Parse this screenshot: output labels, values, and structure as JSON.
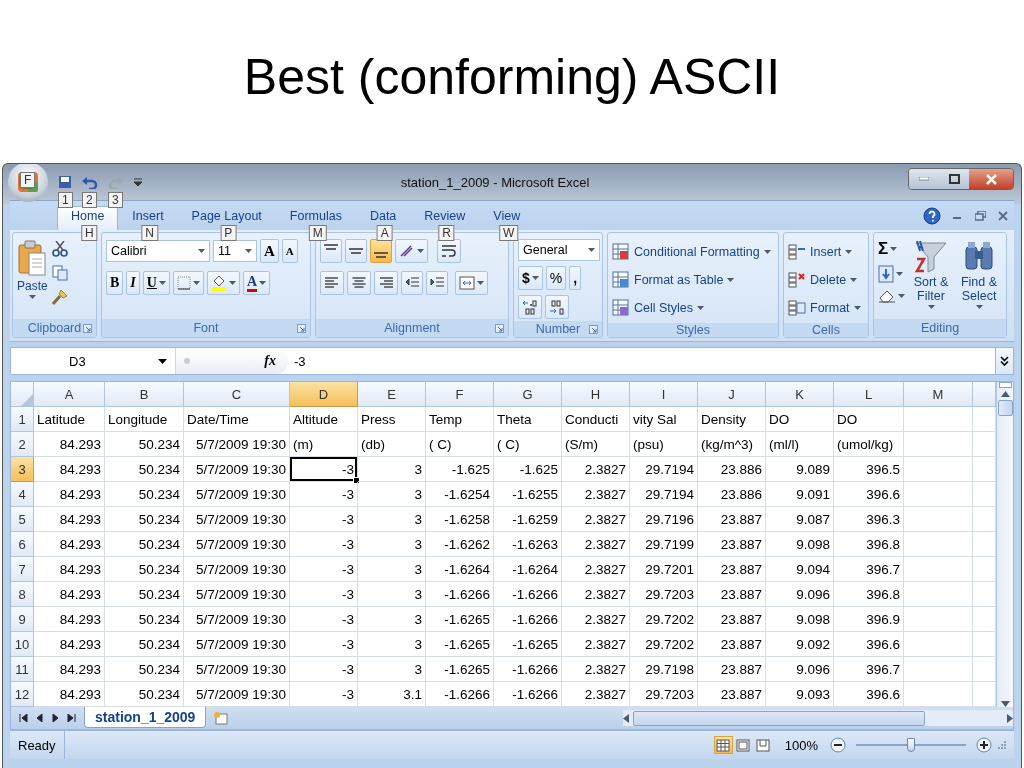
{
  "slide": {
    "title": "Best (conforming) ASCII"
  },
  "window": {
    "title": "station_1_2009 - Microsoft Excel",
    "office_keytip": "F",
    "quick_access_keytips": [
      "1",
      "2",
      "3"
    ]
  },
  "tabs": [
    {
      "label": "Home",
      "keytip": "H",
      "selected": true
    },
    {
      "label": "Insert",
      "keytip": "N",
      "selected": false
    },
    {
      "label": "Page Layout",
      "keytip": "P",
      "selected": false
    },
    {
      "label": "Formulas",
      "keytip": "M",
      "selected": false
    },
    {
      "label": "Data",
      "keytip": "A",
      "selected": false
    },
    {
      "label": "Review",
      "keytip": "R",
      "selected": false
    },
    {
      "label": "View",
      "keytip": "W",
      "selected": false
    }
  ],
  "ribbon": {
    "clipboard": {
      "label": "Clipboard",
      "paste": "Paste"
    },
    "font": {
      "label": "Font",
      "name": "Calibri",
      "size": "11",
      "grow": "A",
      "shrink": "A",
      "bold": "B",
      "italic": "I",
      "underline": "U",
      "font_color": "A"
    },
    "alignment": {
      "label": "Alignment",
      "vertical": [
        {
          "kind": "top",
          "selected": false
        },
        {
          "kind": "middle",
          "selected": false
        },
        {
          "kind": "bottom",
          "selected": true
        }
      ]
    },
    "number": {
      "label": "Number",
      "format": "General",
      "currency": "$",
      "percent": "%",
      "comma": ","
    },
    "styles": {
      "label": "Styles",
      "items": [
        "Conditional Formatting",
        "Format as Table",
        "Cell Styles"
      ]
    },
    "cells": {
      "label": "Cells",
      "items": [
        "Insert",
        "Delete",
        "Format"
      ]
    },
    "editing": {
      "label": "Editing",
      "sum": "Σ",
      "sort": "Sort & Filter",
      "find": "Find & Select"
    }
  },
  "formula_bar": {
    "name_box": "D3",
    "function_label": "fx",
    "value": "-3"
  },
  "sheet": {
    "columns": [
      {
        "label": "A",
        "selected": false
      },
      {
        "label": "B",
        "selected": false
      },
      {
        "label": "C",
        "selected": false
      },
      {
        "label": "D",
        "selected": true
      },
      {
        "label": "E",
        "selected": false
      },
      {
        "label": "F",
        "selected": false
      },
      {
        "label": "G",
        "selected": false
      },
      {
        "label": "H",
        "selected": false
      },
      {
        "label": "I",
        "selected": false
      },
      {
        "label": "J",
        "selected": false
      },
      {
        "label": "K",
        "selected": false
      },
      {
        "label": "L",
        "selected": false
      },
      {
        "label": "M",
        "selected": false
      }
    ],
    "rows": [
      {
        "label": "1",
        "selected": false,
        "cells": [
          {
            "text": "Latitude",
            "kind": "text"
          },
          {
            "text": "Longitude",
            "kind": "text"
          },
          {
            "text": "Date/Time",
            "kind": "text"
          },
          {
            "text": "Altitude",
            "kind": "text"
          },
          {
            "text": "Press",
            "kind": "text"
          },
          {
            "text": "Temp",
            "kind": "text"
          },
          {
            "text": "Theta",
            "kind": "text"
          },
          {
            "text": "Conducti",
            "kind": "text"
          },
          {
            "text": "vity Sal",
            "kind": "text"
          },
          {
            "text": "Density",
            "kind": "text"
          },
          {
            "text": "DO",
            "kind": "text"
          },
          {
            "text": "DO",
            "kind": "text"
          }
        ]
      },
      {
        "label": "2",
        "selected": false,
        "cells": [
          {
            "text": "84.293",
            "kind": "number"
          },
          {
            "text": "50.234",
            "kind": "number"
          },
          {
            "text": "5/7/2009 19:30",
            "kind": "number"
          },
          {
            "text": "(m)",
            "kind": "text"
          },
          {
            "text": "(db)",
            "kind": "text"
          },
          {
            "text": "( C)",
            "kind": "text"
          },
          {
            "text": "( C)",
            "kind": "text"
          },
          {
            "text": "(S/m)",
            "kind": "text"
          },
          {
            "text": "(psu)",
            "kind": "text"
          },
          {
            "text": "(kg/m^3)",
            "kind": "text"
          },
          {
            "text": "(ml/l)",
            "kind": "text"
          },
          {
            "text": "(umol/kg)",
            "kind": "text"
          }
        ]
      },
      {
        "label": "3",
        "selected": true,
        "cells": [
          {
            "text": "84.293",
            "kind": "number"
          },
          {
            "text": "50.234",
            "kind": "number"
          },
          {
            "text": "5/7/2009 19:30",
            "kind": "number"
          },
          {
            "text": "-3",
            "kind": "number"
          },
          {
            "text": "3",
            "kind": "number"
          },
          {
            "text": "-1.625",
            "kind": "number"
          },
          {
            "text": "-1.625",
            "kind": "number"
          },
          {
            "text": "2.3827",
            "kind": "number"
          },
          {
            "text": "29.7194",
            "kind": "number"
          },
          {
            "text": "23.886",
            "kind": "number"
          },
          {
            "text": "9.089",
            "kind": "number"
          },
          {
            "text": "396.5",
            "kind": "number"
          }
        ]
      },
      {
        "label": "4",
        "selected": false,
        "cells": [
          {
            "text": "84.293",
            "kind": "number"
          },
          {
            "text": "50.234",
            "kind": "number"
          },
          {
            "text": "5/7/2009 19:30",
            "kind": "number"
          },
          {
            "text": "-3",
            "kind": "number"
          },
          {
            "text": "3",
            "kind": "number"
          },
          {
            "text": "-1.6254",
            "kind": "number"
          },
          {
            "text": "-1.6255",
            "kind": "number"
          },
          {
            "text": "2.3827",
            "kind": "number"
          },
          {
            "text": "29.7194",
            "kind": "number"
          },
          {
            "text": "23.886",
            "kind": "number"
          },
          {
            "text": "9.091",
            "kind": "number"
          },
          {
            "text": "396.6",
            "kind": "number"
          }
        ]
      },
      {
        "label": "5",
        "selected": false,
        "cells": [
          {
            "text": "84.293",
            "kind": "number"
          },
          {
            "text": "50.234",
            "kind": "number"
          },
          {
            "text": "5/7/2009 19:30",
            "kind": "number"
          },
          {
            "text": "-3",
            "kind": "number"
          },
          {
            "text": "3",
            "kind": "number"
          },
          {
            "text": "-1.6258",
            "kind": "number"
          },
          {
            "text": "-1.6259",
            "kind": "number"
          },
          {
            "text": "2.3827",
            "kind": "number"
          },
          {
            "text": "29.7196",
            "kind": "number"
          },
          {
            "text": "23.887",
            "kind": "number"
          },
          {
            "text": "9.087",
            "kind": "number"
          },
          {
            "text": "396.3",
            "kind": "number"
          }
        ]
      },
      {
        "label": "6",
        "selected": false,
        "cells": [
          {
            "text": "84.293",
            "kind": "number"
          },
          {
            "text": "50.234",
            "kind": "number"
          },
          {
            "text": "5/7/2009 19:30",
            "kind": "number"
          },
          {
            "text": "-3",
            "kind": "number"
          },
          {
            "text": "3",
            "kind": "number"
          },
          {
            "text": "-1.6262",
            "kind": "number"
          },
          {
            "text": "-1.6263",
            "kind": "number"
          },
          {
            "text": "2.3827",
            "kind": "number"
          },
          {
            "text": "29.7199",
            "kind": "number"
          },
          {
            "text": "23.887",
            "kind": "number"
          },
          {
            "text": "9.098",
            "kind": "number"
          },
          {
            "text": "396.8",
            "kind": "number"
          }
        ]
      },
      {
        "label": "7",
        "selected": false,
        "cells": [
          {
            "text": "84.293",
            "kind": "number"
          },
          {
            "text": "50.234",
            "kind": "number"
          },
          {
            "text": "5/7/2009 19:30",
            "kind": "number"
          },
          {
            "text": "-3",
            "kind": "number"
          },
          {
            "text": "3",
            "kind": "number"
          },
          {
            "text": "-1.6264",
            "kind": "number"
          },
          {
            "text": "-1.6264",
            "kind": "number"
          },
          {
            "text": "2.3827",
            "kind": "number"
          },
          {
            "text": "29.7201",
            "kind": "number"
          },
          {
            "text": "23.887",
            "kind": "number"
          },
          {
            "text": "9.094",
            "kind": "number"
          },
          {
            "text": "396.7",
            "kind": "number"
          }
        ]
      },
      {
        "label": "8",
        "selected": false,
        "cells": [
          {
            "text": "84.293",
            "kind": "number"
          },
          {
            "text": "50.234",
            "kind": "number"
          },
          {
            "text": "5/7/2009 19:30",
            "kind": "number"
          },
          {
            "text": "-3",
            "kind": "number"
          },
          {
            "text": "3",
            "kind": "number"
          },
          {
            "text": "-1.6266",
            "kind": "number"
          },
          {
            "text": "-1.6266",
            "kind": "number"
          },
          {
            "text": "2.3827",
            "kind": "number"
          },
          {
            "text": "29.7203",
            "kind": "number"
          },
          {
            "text": "23.887",
            "kind": "number"
          },
          {
            "text": "9.096",
            "kind": "number"
          },
          {
            "text": "396.8",
            "kind": "number"
          }
        ]
      },
      {
        "label": "9",
        "selected": false,
        "cells": [
          {
            "text": "84.293",
            "kind": "number"
          },
          {
            "text": "50.234",
            "kind": "number"
          },
          {
            "text": "5/7/2009 19:30",
            "kind": "number"
          },
          {
            "text": "-3",
            "kind": "number"
          },
          {
            "text": "3",
            "kind": "number"
          },
          {
            "text": "-1.6265",
            "kind": "number"
          },
          {
            "text": "-1.6266",
            "kind": "number"
          },
          {
            "text": "2.3827",
            "kind": "number"
          },
          {
            "text": "29.7202",
            "kind": "number"
          },
          {
            "text": "23.887",
            "kind": "number"
          },
          {
            "text": "9.098",
            "kind": "number"
          },
          {
            "text": "396.9",
            "kind": "number"
          }
        ]
      },
      {
        "label": "10",
        "selected": false,
        "cells": [
          {
            "text": "84.293",
            "kind": "number"
          },
          {
            "text": "50.234",
            "kind": "number"
          },
          {
            "text": "5/7/2009 19:30",
            "kind": "number"
          },
          {
            "text": "-3",
            "kind": "number"
          },
          {
            "text": "3",
            "kind": "number"
          },
          {
            "text": "-1.6265",
            "kind": "number"
          },
          {
            "text": "-1.6265",
            "kind": "number"
          },
          {
            "text": "2.3827",
            "kind": "number"
          },
          {
            "text": "29.7202",
            "kind": "number"
          },
          {
            "text": "23.887",
            "kind": "number"
          },
          {
            "text": "9.092",
            "kind": "number"
          },
          {
            "text": "396.6",
            "kind": "number"
          }
        ]
      },
      {
        "label": "11",
        "selected": false,
        "cells": [
          {
            "text": "84.293",
            "kind": "number"
          },
          {
            "text": "50.234",
            "kind": "number"
          },
          {
            "text": "5/7/2009 19:30",
            "kind": "number"
          },
          {
            "text": "-3",
            "kind": "number"
          },
          {
            "text": "3",
            "kind": "number"
          },
          {
            "text": "-1.6265",
            "kind": "number"
          },
          {
            "text": "-1.6266",
            "kind": "number"
          },
          {
            "text": "2.3827",
            "kind": "number"
          },
          {
            "text": "29.7198",
            "kind": "number"
          },
          {
            "text": "23.887",
            "kind": "number"
          },
          {
            "text": "9.096",
            "kind": "number"
          },
          {
            "text": "396.7",
            "kind": "number"
          }
        ]
      },
      {
        "label": "12",
        "selected": false,
        "cells": [
          {
            "text": "84.293",
            "kind": "number"
          },
          {
            "text": "50.234",
            "kind": "number"
          },
          {
            "text": "5/7/2009 19:30",
            "kind": "number"
          },
          {
            "text": "-3",
            "kind": "number"
          },
          {
            "text": "3.1",
            "kind": "number"
          },
          {
            "text": "-1.6266",
            "kind": "number"
          },
          {
            "text": "-1.6266",
            "kind": "number"
          },
          {
            "text": "2.3827",
            "kind": "number"
          },
          {
            "text": "29.7203",
            "kind": "number"
          },
          {
            "text": "23.887",
            "kind": "number"
          },
          {
            "text": "9.093",
            "kind": "number"
          },
          {
            "text": "396.6",
            "kind": "number"
          }
        ]
      }
    ]
  },
  "sheet_tabs": [
    {
      "label": "station_1_2009",
      "selected": true
    }
  ],
  "status_bar": {
    "status": "Ready",
    "zoom": "100%",
    "views": [
      {
        "kind": "normal",
        "selected": true
      },
      {
        "kind": "page-layout",
        "selected": false
      },
      {
        "kind": "page-break",
        "selected": false
      }
    ],
    "zoom_slider": {
      "level": 0.5
    }
  }
}
